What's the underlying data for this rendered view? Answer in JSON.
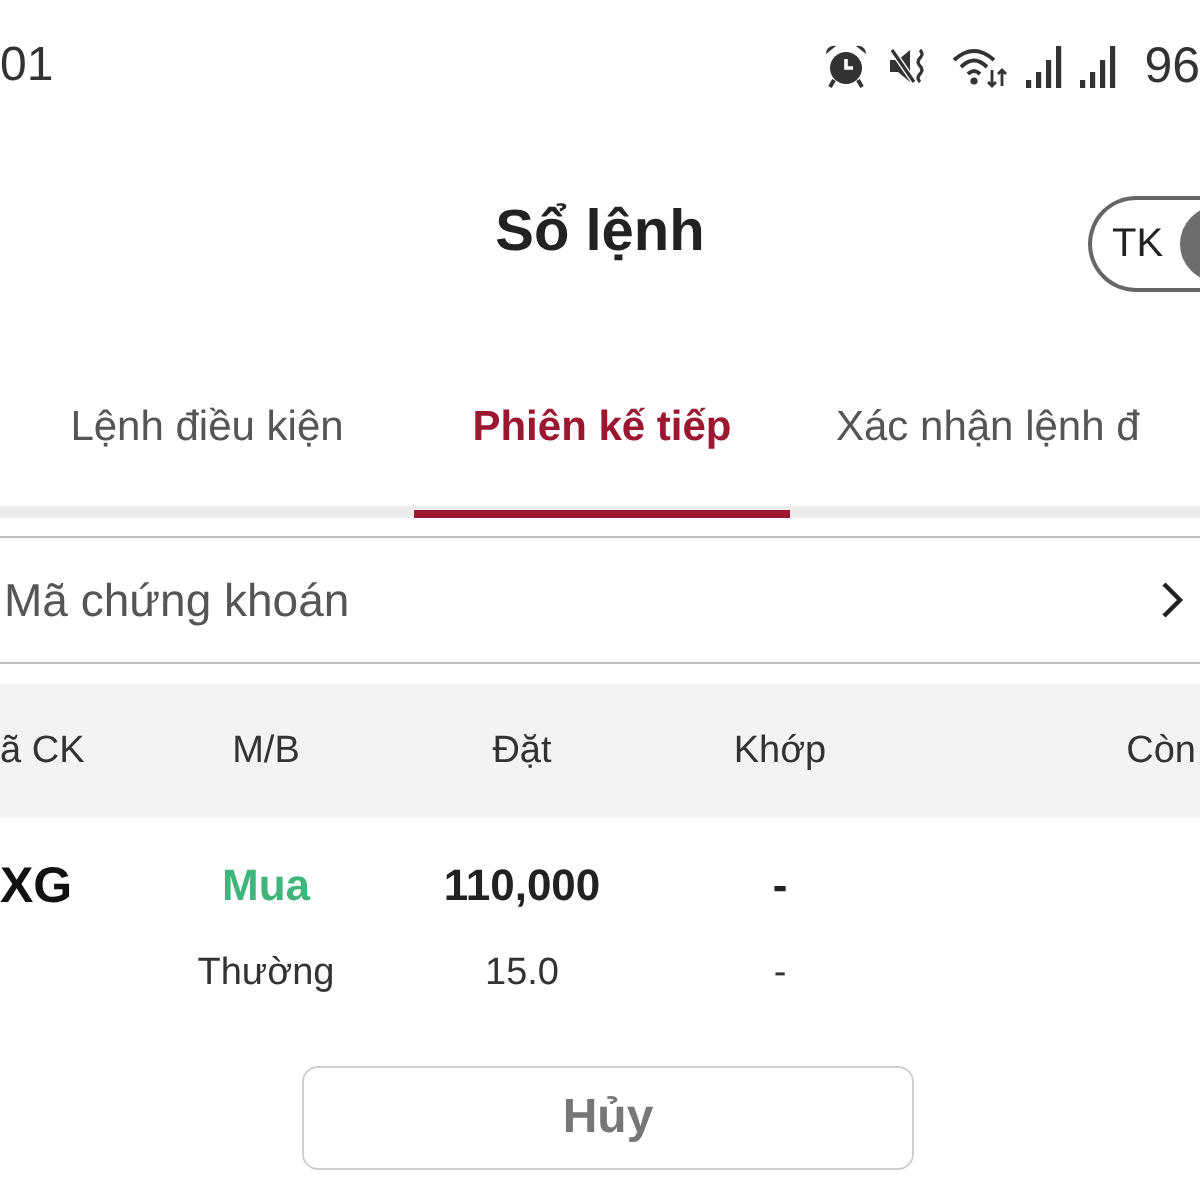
{
  "status_bar": {
    "time": "01",
    "battery": "96"
  },
  "header": {
    "title": "Sổ lệnh",
    "toggle": {
      "label": "TK"
    }
  },
  "tabs": [
    {
      "label": "Lệnh điều kiện",
      "selected": false
    },
    {
      "label": "Phiên kế tiếp",
      "selected": true
    },
    {
      "label": "Xác nhận lệnh đ",
      "selected": false
    }
  ],
  "filter": {
    "label": "Mã chứng khoán"
  },
  "table": {
    "columns": [
      "ã CK",
      "M/B",
      "Đặt",
      "Khớp",
      "Còn"
    ],
    "rows": [
      {
        "cells": [
          {
            "kind": "symbol",
            "main": "XG"
          },
          {
            "kind": "buy",
            "main": "Mua",
            "sub": "Thường"
          },
          {
            "kind": "value",
            "main": "110,000",
            "sub": "15.0"
          },
          {
            "kind": "value",
            "main": "-",
            "sub": "-"
          }
        ]
      }
    ]
  },
  "cancel_button": {
    "label": "Hủy"
  }
}
